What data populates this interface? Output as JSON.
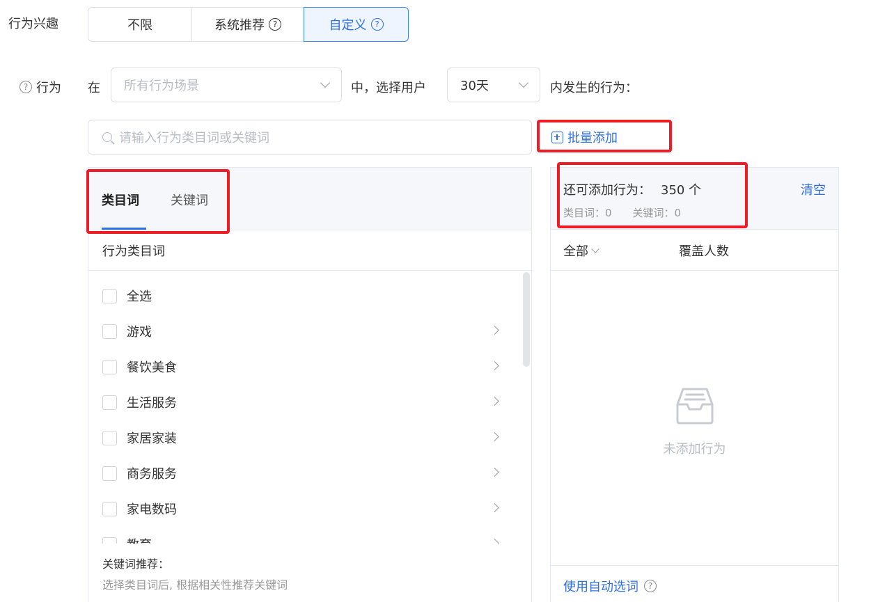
{
  "interest": {
    "label": "行为兴趣",
    "options": [
      "不限",
      "系统推荐",
      "自定义"
    ],
    "selected": "自定义"
  },
  "behavior": {
    "label": "行为",
    "in_text": "在",
    "scene_placeholder": "所有行为场景",
    "middle_text": "中，选择用户",
    "days_value": "30天",
    "suffix_text": "内发生的行为："
  },
  "search": {
    "placeholder": "请输入行为类目词或关键词"
  },
  "bulk_add": "批量添加",
  "left_panel": {
    "tabs": [
      "类目词",
      "关键词"
    ],
    "active_tab": "类目词",
    "subheader": "行为类目词",
    "items": [
      {
        "label": "全选",
        "has_arrow": false
      },
      {
        "label": "游戏",
        "has_arrow": true
      },
      {
        "label": "餐饮美食",
        "has_arrow": true
      },
      {
        "label": "生活服务",
        "has_arrow": true
      },
      {
        "label": "家居家装",
        "has_arrow": true
      },
      {
        "label": "商务服务",
        "has_arrow": true
      },
      {
        "label": "家电数码",
        "has_arrow": true
      },
      {
        "label": "教育",
        "has_arrow": true
      }
    ],
    "keyword_title": "关键词推荐：",
    "keyword_desc": "选择类目词后, 根据相关性推荐关键词"
  },
  "right_panel": {
    "quota_label": "还可添加行为：",
    "quota_value": "350 个",
    "category_count": "类目词：0",
    "keyword_count": "关键词：0",
    "clear_label": "清空",
    "filter_label": "全部",
    "coverage_label": "覆盖人数",
    "empty_text": "未添加行为",
    "auto_select": "使用自动选词"
  },
  "colors": {
    "accent": "#2f6fe0",
    "highlight_border": "#ee1c25",
    "panel_header": "#f5f7fa"
  }
}
